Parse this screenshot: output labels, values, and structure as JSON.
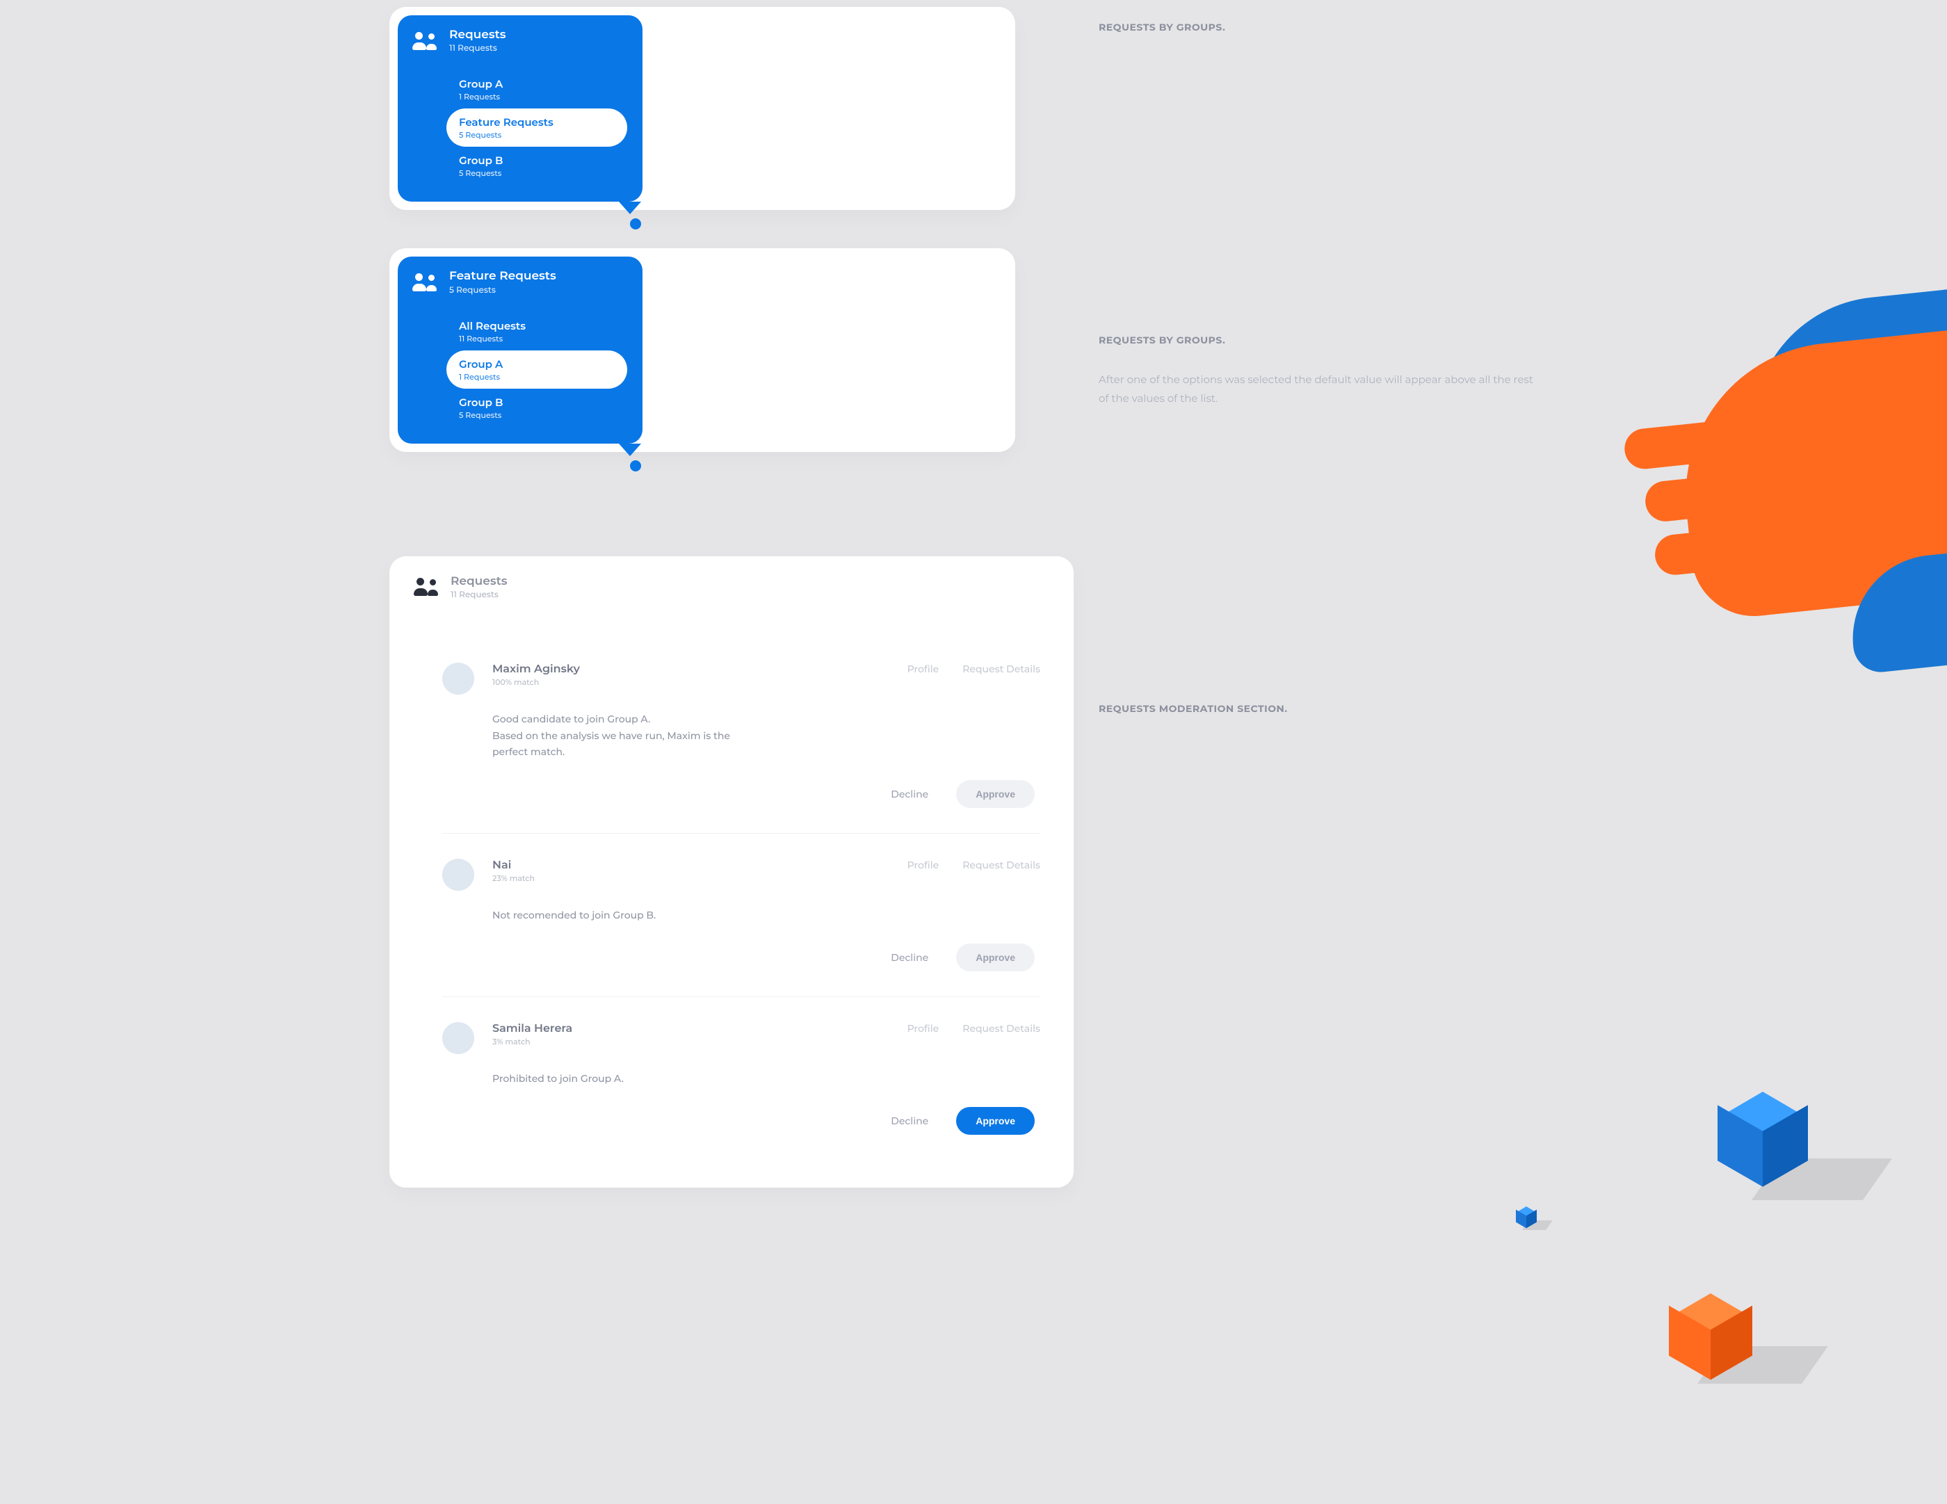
{
  "annotations": {
    "a1": {
      "title": "REQUESTS BY GROUPS."
    },
    "a2": {
      "title": "REQUESTS BY GROUPS.",
      "body": "After one of the options was selected the default value will appear above all the rest of the values of the list."
    },
    "a3": {
      "title": "REQUESTS MODERATION SECTION."
    }
  },
  "dropdown1": {
    "title": "Requests",
    "subtitle": "11 Requests",
    "items": [
      {
        "name": "Group A",
        "sub": "1 Requests",
        "selected": false
      },
      {
        "name": "Feature Requests",
        "sub": "5 Requests",
        "selected": true
      },
      {
        "name": "Group B",
        "sub": "5 Requests",
        "selected": false
      }
    ]
  },
  "dropdown2": {
    "title": "Feature Requests",
    "subtitle": "5 Requests",
    "items": [
      {
        "name": "All Requests",
        "sub": "11 Requests",
        "selected": false
      },
      {
        "name": "Group A",
        "sub": "1 Requests",
        "selected": true
      },
      {
        "name": "Group B",
        "sub": "5 Requests",
        "selected": false
      }
    ]
  },
  "moderation": {
    "title": "Requests",
    "subtitle": "11 Requests",
    "links": {
      "profile": "Profile",
      "details": "Request Details"
    },
    "actions": {
      "decline": "Decline",
      "approve": "Approve"
    },
    "requests": [
      {
        "name": "Maxim Aginsky",
        "match": "100% match",
        "desc": "Good candidate to join Group A.\nBased on the analysis we have run, Maxim is the perfect match.",
        "approve_active": false
      },
      {
        "name": "Nai",
        "match": "23% match",
        "desc": "Not recomended to join Group B.",
        "approve_active": false
      },
      {
        "name": "Samila Herera",
        "match": "3% match",
        "desc": "Prohibited to join Group A.",
        "approve_active": true
      }
    ]
  }
}
